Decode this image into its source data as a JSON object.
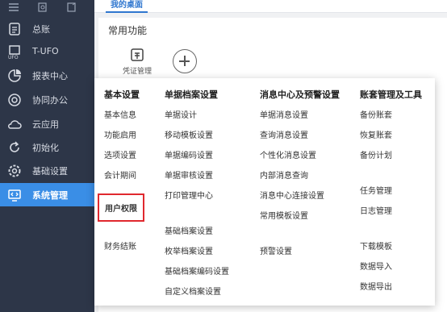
{
  "sidebar": {
    "items": [
      {
        "label": "总账",
        "icon": "ledger-icon"
      },
      {
        "label": "T-UFO",
        "icon": "ufo-icon"
      },
      {
        "label": "报表中心",
        "icon": "pie-chart-icon"
      },
      {
        "label": "协同办公",
        "icon": "target-icon"
      },
      {
        "label": "云应用",
        "icon": "cloud-icon"
      },
      {
        "label": "初始化",
        "icon": "refresh-icon"
      },
      {
        "label": "基础设置",
        "icon": "gear-icon"
      },
      {
        "label": "系统管理",
        "icon": "monitor-code-icon",
        "active": true
      }
    ],
    "accent": "#3a8ee6"
  },
  "topbar": {
    "home_tab": "我的桌面"
  },
  "content": {
    "section_title": "常用功能",
    "shortcut_label": "凭证管理"
  },
  "menu": {
    "columns": [
      {
        "header": "基本设置",
        "items": [
          "基本信息",
          "功能启用",
          "选项设置",
          "会计期间",
          "用户权限",
          "财务结账"
        ]
      },
      {
        "header": "单据档案设置",
        "items": [
          "单据设计",
          "移动模板设置",
          "单据编码设置",
          "单据审核设置",
          "打印管理中心",
          "基础档案设置",
          "枚举档案设置",
          "基础档案编码设置",
          "自定义档案设置"
        ]
      },
      {
        "header": "消息中心及预警设置",
        "items": [
          "单据消息设置",
          "查询消息设置",
          "个性化消息设置",
          "内部消息查询",
          "消息中心连接设置",
          "常用模板设置",
          "预警设置"
        ]
      },
      {
        "header": "账套管理及工具",
        "items": [
          "备份账套",
          "恢复账套",
          "备份计划",
          "任务管理",
          "日志管理",
          "下载模板",
          "数据导入",
          "数据导出"
        ]
      }
    ],
    "highlight_color": "#e0282e"
  }
}
